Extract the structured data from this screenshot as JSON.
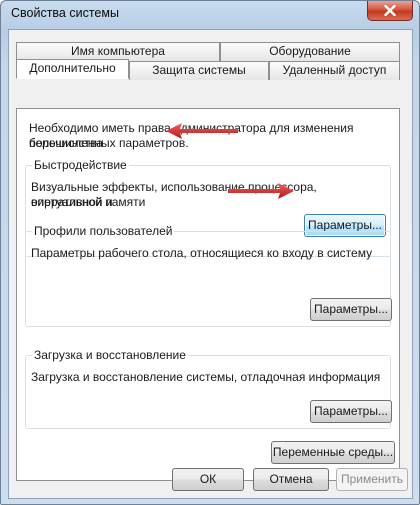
{
  "window": {
    "title": "Свойства системы"
  },
  "tabs": {
    "row1": [
      "Имя компьютера",
      "Оборудование"
    ],
    "row2": [
      "Дополнительно",
      "Защита системы",
      "Удаленный доступ"
    ],
    "active": "Дополнительно"
  },
  "notice": {
    "line1": "Необходимо иметь права администратора для изменения большинства",
    "line2": "перечисленных параметров."
  },
  "performance": {
    "title": "Быстродействие",
    "line1": "Визуальные эффекты, использование процессора, оперативной и",
    "line2": "виртуальной памяти",
    "button": "Параметры..."
  },
  "profiles": {
    "title": "Профили пользователей",
    "line1": "Параметры рабочего стола, относящиеся ко входу в систему",
    "button": "Параметры..."
  },
  "startup": {
    "title": "Загрузка и восстановление",
    "line1": "Загрузка и восстановление системы, отладочная информация",
    "button": "Параметры..."
  },
  "env_button": "Переменные среды...",
  "footer": {
    "ok": "ОК",
    "cancel": "Отмена",
    "apply": "Применить"
  },
  "icons": {
    "close": "close-icon",
    "annotation": "red-arrow-icon"
  },
  "colors": {
    "annotation_arrow": "#d42020",
    "close_button": "#c43a22"
  }
}
